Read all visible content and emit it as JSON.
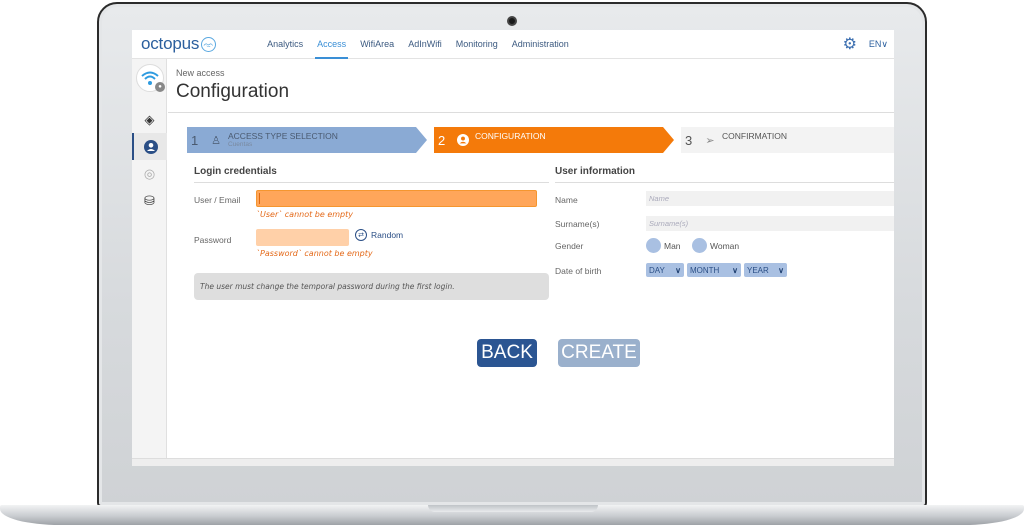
{
  "app": {
    "logo_text": "octopus",
    "logo_mark": "ᨎ",
    "nav": [
      {
        "label": "Analytics",
        "active": false
      },
      {
        "label": "Access",
        "active": true
      },
      {
        "label": "WifiArea",
        "active": false
      },
      {
        "label": "AdInWifi",
        "active": false
      },
      {
        "label": "Monitoring",
        "active": false
      },
      {
        "label": "Administration",
        "active": false
      }
    ],
    "settings_icon": "⚙",
    "language": "EN∨"
  },
  "sidebar": {
    "logo_icon": "wifi-icon",
    "items": [
      {
        "name": "ticket-icon",
        "glyph": "🎟",
        "active": false
      },
      {
        "name": "user-icon",
        "glyph": "●",
        "active": true
      },
      {
        "name": "upload-icon",
        "glyph": "◎",
        "active": false
      },
      {
        "name": "database-icon",
        "glyph": "⛁",
        "active": false
      }
    ]
  },
  "header": {
    "breadcrumb": "New access",
    "title": "Configuration"
  },
  "stepper": {
    "steps": [
      {
        "num": "1",
        "icon": "user-add-icon",
        "glyph": "⚲",
        "title": "ACCESS TYPE SELECTION",
        "subtitle": "Cuentas",
        "state": "done"
      },
      {
        "num": "2",
        "icon": "user-circle-icon",
        "glyph": "●",
        "title": "CONFIGURATION",
        "subtitle": "",
        "state": "active"
      },
      {
        "num": "3",
        "icon": "send-icon",
        "glyph": "➢",
        "title": "CONFIRMATION",
        "subtitle": "",
        "state": "pending"
      }
    ]
  },
  "login": {
    "section_title": "Login credentials",
    "user_label": "User / Email",
    "user_value": "",
    "user_error": "`User` cannot be empty",
    "password_label": "Password",
    "password_value": "",
    "password_error": "`Password` cannot be empty",
    "random_label": "Random",
    "random_icon": "⇄",
    "note": "The user must change the temporal password during the first login."
  },
  "user_info": {
    "section_title": "User information",
    "name_label": "Name",
    "name_placeholder": "Name",
    "surname_label": "Surname(s)",
    "surname_placeholder": "Surname(s)",
    "gender_label": "Gender",
    "gender_options": [
      "Man",
      "Woman"
    ],
    "dob_label": "Date of birth",
    "day": "DAY",
    "month": "MONTH",
    "year": "YEAR",
    "chevron": "∨"
  },
  "actions": {
    "back": "BACK",
    "create": "CREATE"
  },
  "colors": {
    "primary": "#2b5592",
    "accent": "#f47a0a",
    "error": "#e46a1a",
    "step_done": "#8aaad4"
  }
}
